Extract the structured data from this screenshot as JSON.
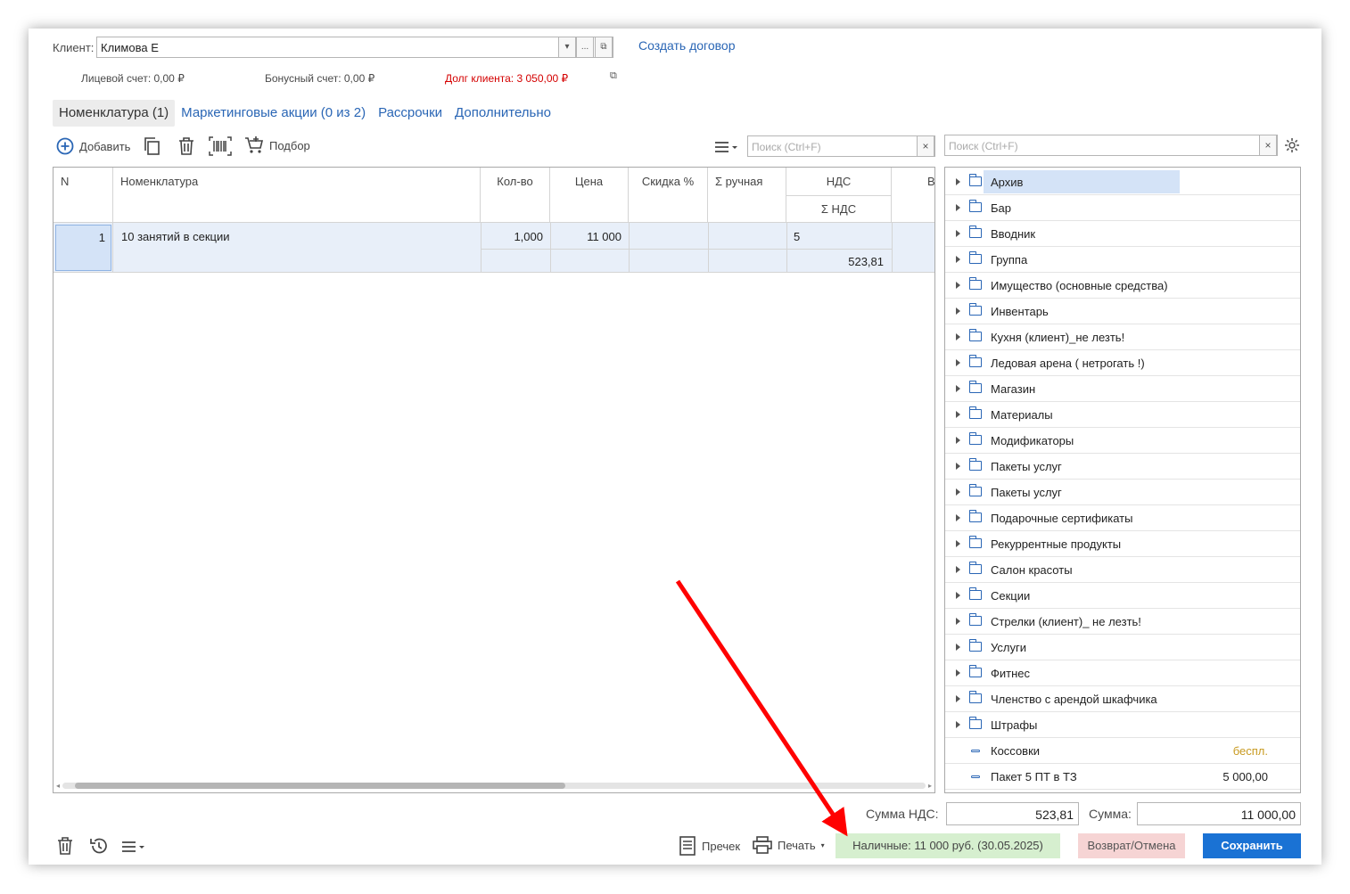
{
  "client": {
    "label": "Клиент:",
    "value": "Климова Е",
    "dropdown_glyph": "▾",
    "more_glyph": "...",
    "open_glyph": "⧉",
    "create_contract": "Создать договор"
  },
  "accounts": {
    "personal": "Лицевой счет: 0,00 ₽",
    "bonus": "Бонусный счет: 0,00 ₽",
    "debt": "Долг клиента: 3 050,00 ₽",
    "debt_color": "#d40000",
    "open_glyph": "⧉"
  },
  "tabs": [
    {
      "label": "Номенклатура (1)",
      "active": true
    },
    {
      "label": "Маркетинговые акции (0 из 2)"
    },
    {
      "label": "Рассрочки"
    },
    {
      "label": "Дополнительно"
    }
  ],
  "toolbar": {
    "add_label": "Добавить",
    "pick_label": "Подбор",
    "search_placeholder": "Поиск (Ctrl+F)",
    "clear_glyph": "×"
  },
  "grid": {
    "headers": {
      "n": "N",
      "item": "Номенклатура",
      "qty": "Кол-во",
      "price": "Цена",
      "discount": "Скидка %",
      "manual": "Σ ручная",
      "vat": "НДС",
      "vat_sum": "Σ НДС",
      "more": "В"
    },
    "rows": [
      {
        "n": "1",
        "item": "10 занятий в секции",
        "qty": "1,000",
        "price": "11 000",
        "vat": "5",
        "vat_sum": "523,81"
      }
    ]
  },
  "tree": {
    "search_placeholder": "Поиск (Ctrl+F)",
    "clear_glyph": "×",
    "folders": [
      "Архив",
      "Бар",
      "Вводник",
      "Группа",
      "Имущество (основные средства)",
      "Инвентарь",
      "Кухня (клиент)_не лезть!",
      "Ледовая арена ( нетрогать !)",
      "Магазин",
      "Материалы",
      "Модификаторы",
      "Пакеты услуг",
      "Пакеты услуг",
      "Подарочные сертификаты",
      "Рекуррентные продукты",
      "Салон красоты",
      "Секции",
      "Стрелки (клиент)_ не лезть!",
      "Услуги",
      "Фитнес",
      "Членство с арендой шкафчика",
      "Штрафы"
    ],
    "items": [
      {
        "name": "Коссовки",
        "price": "беспл.",
        "price_color": "#c89a20"
      },
      {
        "name": "Пакет 5 ПТ в ТЗ",
        "price": "5 000,00",
        "price_color": "#222222"
      }
    ]
  },
  "totals": {
    "vat_label": "Сумма НДС:",
    "vat_value": "523,81",
    "sum_label": "Сумма:",
    "sum_value": "11 000,00"
  },
  "footer": {
    "precheck": "Пречек",
    "print": "Печать",
    "payment": "Наличные: 11 000 руб. (30.05.2025)",
    "payment_bg": "#d6efcf",
    "refund": "Возврат/Отмена",
    "refund_bg": "#f6d4d4",
    "save": "Сохранить",
    "save_bg": "#1a72d4"
  }
}
